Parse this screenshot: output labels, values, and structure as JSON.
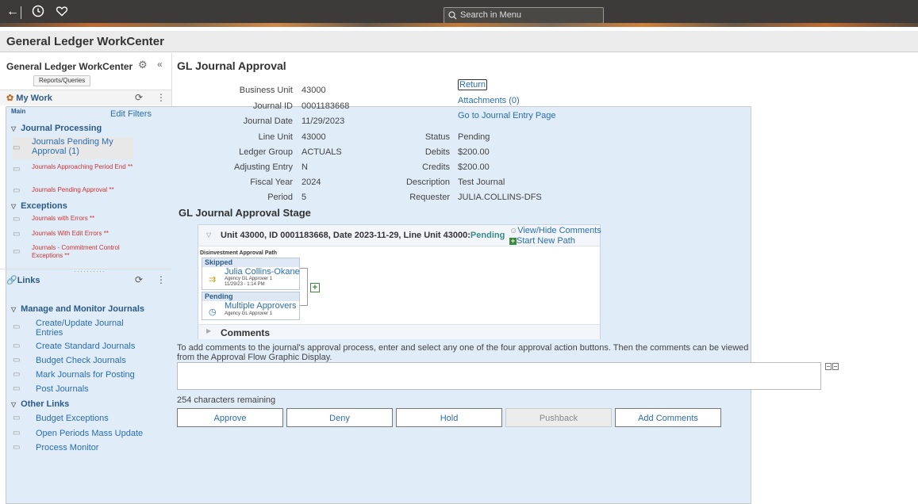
{
  "topbar": {
    "back_icon": "arrow-left-icon",
    "recent_icon": "clock-icon",
    "favorite_icon": "heart-icon",
    "search_placeholder": "Search in Menu"
  },
  "page_title": "General Ledger WorkCenter",
  "sidebar": {
    "title": "General Ledger WorkCenter",
    "tabs": [
      "Main",
      "Reports/Queries"
    ],
    "my_work": {
      "label": "My Work",
      "edit_filters": "Edit Filters",
      "groups": [
        {
          "label": "Journal Processing",
          "items": [
            {
              "label": "Journals Pending My Approval (1)",
              "alert": false,
              "selected": true
            },
            {
              "label": "Journals Approaching Period End **",
              "alert": true
            },
            {
              "label": "Journals Pending Approval **",
              "alert": true
            }
          ]
        },
        {
          "label": "Exceptions",
          "items": [
            {
              "label": "Journals with Errors **",
              "alert": true
            },
            {
              "label": "Journals With Edit Errors **",
              "alert": true
            },
            {
              "label": "Journals - Commitment Control Exceptions **",
              "alert": true
            }
          ]
        }
      ]
    },
    "links": {
      "label": "Links",
      "groups": [
        {
          "label": "Manage and Monitor Journals",
          "items": [
            "Create/Update Journal Entries",
            "Create Standard Journals",
            "Budget Check Journals",
            "Mark Journals for Posting",
            "Post Journals"
          ]
        },
        {
          "label": "Other Links",
          "items": [
            "Budget Exceptions",
            "Open Periods Mass Update",
            "Process Monitor"
          ]
        }
      ]
    }
  },
  "main": {
    "title": "GL Journal Approval",
    "fields_left": [
      {
        "label": "Business Unit",
        "value": "43000"
      },
      {
        "label": "Journal ID",
        "value": "0001183668"
      },
      {
        "label": "Journal Date",
        "value": "11/29/2023"
      },
      {
        "label": "Line Unit",
        "value": "43000"
      },
      {
        "label": "Ledger Group",
        "value": "ACTUALS"
      },
      {
        "label": "Adjusting Entry",
        "value": "N"
      },
      {
        "label": "Fiscal Year",
        "value": "2024"
      },
      {
        "label": "Period",
        "value": "5"
      }
    ],
    "fields_right": [
      {
        "label": "Status",
        "value": "Pending"
      },
      {
        "label": "Debits",
        "value": "$200.00"
      },
      {
        "label": "Credits",
        "value": "$200.00"
      },
      {
        "label": "Description",
        "value": "Test Journal"
      },
      {
        "label": "Requester",
        "value": "JULIA.COLLINS-DFS"
      }
    ],
    "links": {
      "return": "Return",
      "attachments": "Attachments (0)",
      "go_to_entry": "Go to Journal Entry Page"
    },
    "stage_title": "GL Journal Approval Stage",
    "approval": {
      "header_text": "Unit 43000, ID 0001183668, Date 2023-11-29, Line Unit 43000:",
      "header_status": "Pending",
      "view_hide_comments": "View/Hide Comments",
      "start_new_path": "Start New Path",
      "path_label": "Disinvestment Approval Path",
      "steps": [
        {
          "status": "Skipped",
          "name": "Julia Collins-Okane",
          "role": "Agency GL Approver 1",
          "timestamp": "11/29/23 - 1:14 PM"
        },
        {
          "status": "Pending",
          "name": "Multiple Approvers",
          "role": "Agency GL Approver 1"
        }
      ],
      "comments_label": "Comments"
    },
    "instructions": "To add comments to the journal's approval process, enter and select any one of the four approval action buttons. Then the comments can be viewed from the Approval Flow Graphic Display.",
    "comment_value": "",
    "chars_remaining": "254 characters remaining",
    "buttons": [
      {
        "label": "Approve",
        "enabled": true
      },
      {
        "label": "Deny",
        "enabled": true
      },
      {
        "label": "Hold",
        "enabled": true
      },
      {
        "label": "Pushback",
        "enabled": false
      },
      {
        "label": "Add Comments",
        "enabled": true
      }
    ]
  }
}
